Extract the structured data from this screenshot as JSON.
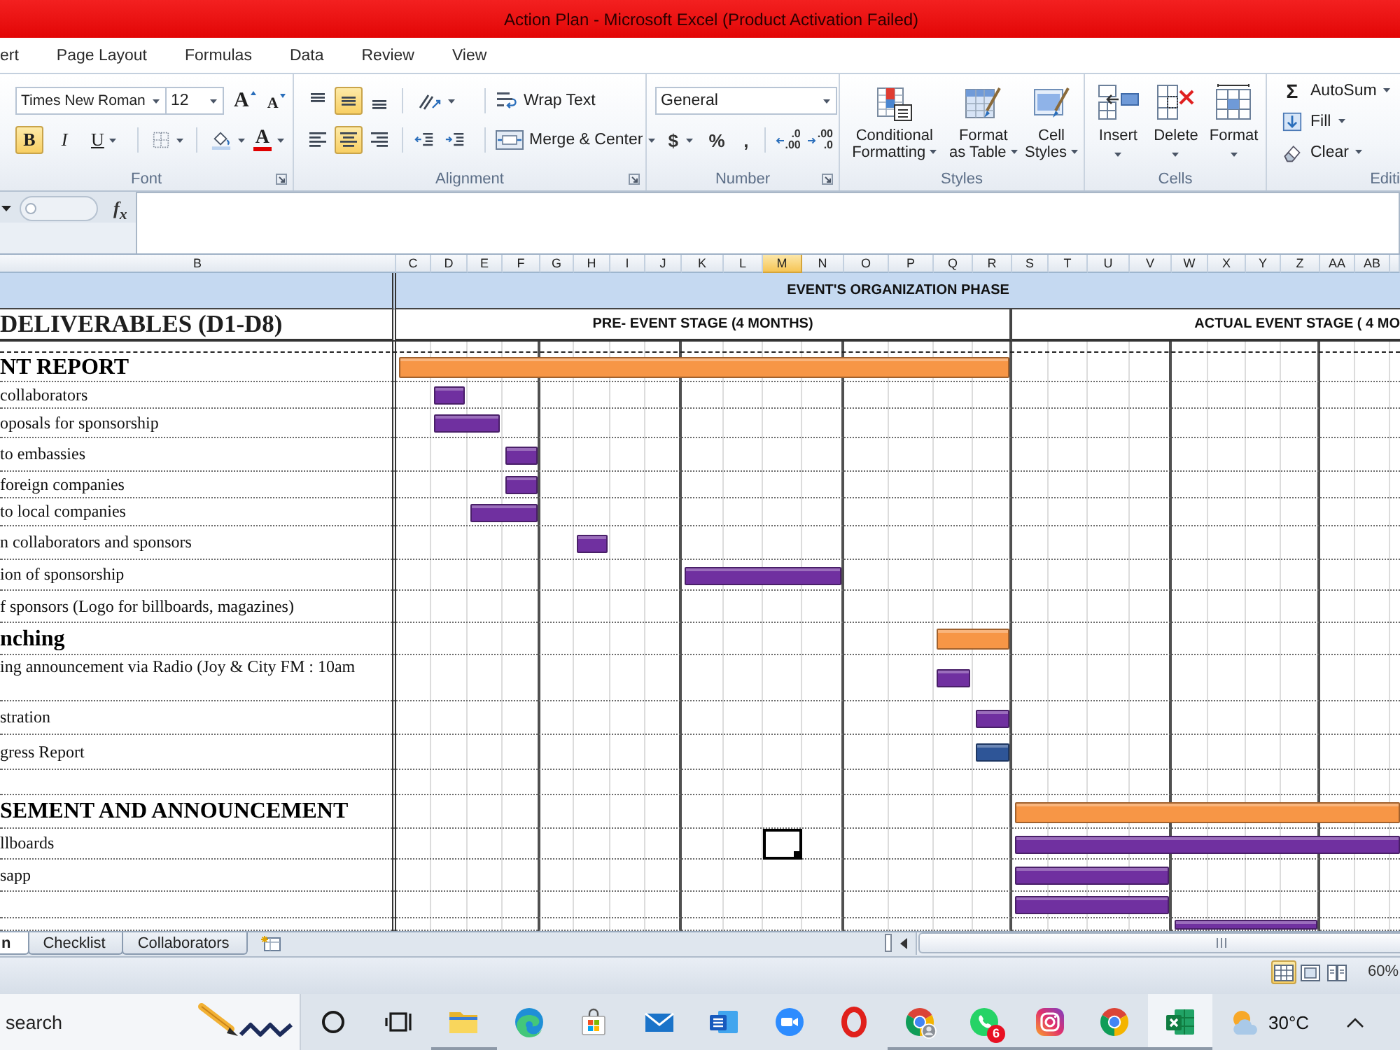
{
  "window": {
    "title": "Action Plan - Microsoft Excel (Product Activation Failed)"
  },
  "menu_tabs": [
    {
      "label": "ert",
      "selected": false
    },
    {
      "label": "Page Layout",
      "selected": false
    },
    {
      "label": "Formulas",
      "selected": false
    },
    {
      "label": "Data",
      "selected": false
    },
    {
      "label": "Review",
      "selected": false
    },
    {
      "label": "View",
      "selected": false
    }
  ],
  "ribbon": {
    "font": {
      "title": "Font",
      "font_name": "Times New Roman",
      "font_size": "12",
      "grow_label": "A",
      "shrink_label": "A",
      "styles": [
        {
          "kind": "bold",
          "label": "B",
          "on": true
        },
        {
          "kind": "italic",
          "label": "I",
          "on": false
        },
        {
          "kind": "underline",
          "label": "U",
          "on": false
        }
      ],
      "color_label": "A"
    },
    "alignment": {
      "title": "Alignment",
      "vertical": [
        {
          "kind": "top",
          "selected": false
        },
        {
          "kind": "middle",
          "selected": true
        },
        {
          "kind": "bottom",
          "selected": false
        }
      ],
      "horizontal": [
        {
          "kind": "left",
          "selected": false
        },
        {
          "kind": "center",
          "selected": true
        },
        {
          "kind": "right",
          "selected": false
        }
      ],
      "wrap_label": "Wrap Text",
      "merge_label": "Merge & Center"
    },
    "number": {
      "title": "Number",
      "format": "General",
      "symbols": [
        {
          "kind": "currency",
          "label": "$"
        },
        {
          "kind": "percent",
          "label": "%"
        },
        {
          "kind": "comma",
          "label": ","
        }
      ],
      "decimals": [
        {
          "kind": "increase",
          "lines": [
            ".0",
            ".00"
          ]
        },
        {
          "kind": "decrease",
          "lines": [
            ".00",
            ".0"
          ]
        }
      ]
    },
    "styles": {
      "title": "Styles",
      "buttons": [
        {
          "kind": "conditional",
          "lines": [
            "Conditional",
            "Formatting"
          ]
        },
        {
          "kind": "table",
          "lines": [
            "Format",
            "as Table"
          ]
        },
        {
          "kind": "cell-styles",
          "lines": [
            "Cell",
            "Styles"
          ]
        }
      ]
    },
    "cells": {
      "title": "Cells",
      "buttons": [
        {
          "kind": "insert",
          "label": "Insert"
        },
        {
          "kind": "delete",
          "label": "Delete"
        },
        {
          "kind": "format",
          "label": "Format"
        }
      ]
    },
    "editing": {
      "title": "Editi",
      "autosum": {
        "symbol": "Σ",
        "label": "AutoSum"
      },
      "fill": "Fill",
      "clear": "Clear"
    }
  },
  "formula_bar": {
    "function_label": "f$_{x}$"
  },
  "sheet": {
    "columns": [
      {
        "label": "B",
        "selected": false
      },
      {
        "label": "C",
        "selected": false
      },
      {
        "label": "D",
        "selected": false
      },
      {
        "label": "E",
        "selected": false
      },
      {
        "label": "F",
        "selected": false
      },
      {
        "label": "G",
        "selected": false
      },
      {
        "label": "H",
        "selected": false
      },
      {
        "label": "I",
        "selected": false
      },
      {
        "label": "J",
        "selected": false
      },
      {
        "label": "K",
        "selected": false
      },
      {
        "label": "L",
        "selected": false
      },
      {
        "label": "M",
        "selected": true
      },
      {
        "label": "N",
        "selected": false
      },
      {
        "label": "O",
        "selected": false
      },
      {
        "label": "P",
        "selected": false
      },
      {
        "label": "Q",
        "selected": false
      },
      {
        "label": "R",
        "selected": false
      },
      {
        "label": "S",
        "selected": false
      },
      {
        "label": "T",
        "selected": false
      },
      {
        "label": "U",
        "selected": false
      },
      {
        "label": "V",
        "selected": false
      },
      {
        "label": "W",
        "selected": false
      },
      {
        "label": "X",
        "selected": false
      },
      {
        "label": "Y",
        "selected": false
      },
      {
        "label": "Z",
        "selected": false
      },
      {
        "label": "AA",
        "selected": false
      },
      {
        "label": "AB",
        "selected": false
      }
    ],
    "phase_title": "EVENT'S ORGANIZATION PHASE",
    "deliverables_title": "DELIVERABLES (D1-D8)",
    "stages": [
      {
        "label": "PRE- EVENT STAGE (4 MONTHS)"
      },
      {
        "label": "ACTUAL EVENT STAGE ( 4 MO"
      }
    ],
    "rows": [
      {
        "kind": "spacer",
        "active_cell": false
      },
      {
        "kind": "heading",
        "label": "NT REPORT",
        "active_cell": false,
        "bar": {
          "color": "#f79646"
        }
      },
      {
        "kind": "task",
        "label": "collaborators",
        "active_cell": false,
        "bar": {
          "color": "#7030a0"
        }
      },
      {
        "kind": "task",
        "label": "oposals for sponsorship",
        "active_cell": false,
        "bar": {
          "color": "#7030a0"
        }
      },
      {
        "kind": "task",
        "label": "to embassies",
        "active_cell": false,
        "bar": {
          "color": "#7030a0"
        }
      },
      {
        "kind": "task",
        "label": "foreign companies",
        "active_cell": false,
        "bar": {
          "color": "#7030a0"
        }
      },
      {
        "kind": "task",
        "label": "to local companies",
        "active_cell": false,
        "bar": {
          "color": "#7030a0"
        }
      },
      {
        "kind": "task",
        "label": "n collaborators and sponsors",
        "active_cell": false,
        "bar": {
          "color": "#7030a0"
        }
      },
      {
        "kind": "task",
        "label": "ion of sponsorship",
        "active_cell": false,
        "bar": {
          "color": "#7030a0"
        }
      },
      {
        "kind": "task",
        "label": "f sponsors (Logo for billboards, magazines)",
        "active_cell": false
      },
      {
        "kind": "heading",
        "label": "nching",
        "active_cell": false,
        "bar": {
          "color": "#f79646"
        }
      },
      {
        "kind": "task",
        "label": "ing announcement via Radio (Joy & City FM : 10am",
        "active_cell": false,
        "bar": {
          "color": "#7030a0"
        }
      },
      {
        "kind": "task",
        "label": "stration",
        "active_cell": false,
        "bar": {
          "color": "#7030a0"
        }
      },
      {
        "kind": "task",
        "label": "gress Report",
        "active_cell": false,
        "bar": {
          "color": "#2e5597"
        }
      },
      {
        "kind": "task",
        "active_cell": false
      },
      {
        "kind": "heading",
        "label": "SEMENT AND ANNOUNCEMENT",
        "active_cell": false,
        "bar": {
          "color": "#f79646"
        }
      },
      {
        "kind": "task",
        "label": "llboards",
        "active_cell": true,
        "bar": {
          "color": "#7030a0"
        }
      },
      {
        "kind": "task",
        "label": "sapp",
        "active_cell": false,
        "bar": {
          "color": "#7030a0"
        }
      },
      {
        "kind": "task",
        "active_cell": false,
        "bar": {
          "color": "#7030a0"
        }
      },
      {
        "kind": "task",
        "active_cell": false,
        "bar": {
          "color": "#7030a0"
        }
      }
    ]
  },
  "sheet_tabs": [
    {
      "label": "n",
      "selected": true
    },
    {
      "label": "Checklist",
      "selected": false
    },
    {
      "label": "Collaborators",
      "selected": false
    }
  ],
  "status_bar": {
    "views": [
      {
        "kind": "normal",
        "selected": true
      },
      {
        "kind": "page-layout",
        "selected": false
      },
      {
        "kind": "page-break",
        "selected": false
      }
    ],
    "zoom": "60%"
  },
  "taskbar": {
    "search_placeholder": "search",
    "apps": [
      {
        "kind": "ring",
        "running": false,
        "active": false
      },
      {
        "kind": "task-view",
        "running": false,
        "active": false
      },
      {
        "kind": "folder",
        "running": true,
        "active": false
      },
      {
        "kind": "swirl",
        "running": false,
        "active": false
      },
      {
        "kind": "store-bag",
        "running": false,
        "active": false
      },
      {
        "kind": "envelope",
        "running": false,
        "active": false
      },
      {
        "kind": "doc-tile",
        "running": false,
        "active": false
      },
      {
        "kind": "video",
        "running": false,
        "active": false
      },
      {
        "kind": "red-ring",
        "running": false,
        "active": false
      },
      {
        "kind": "tricolor-avatar",
        "running": true,
        "active": false
      },
      {
        "kind": "chat-phone",
        "running": true,
        "active": false,
        "badge": "6"
      },
      {
        "kind": "camera",
        "running": true,
        "active": false
      },
      {
        "kind": "tricolor",
        "running": true,
        "active": false
      },
      {
        "kind": "spreadsheet",
        "running": true,
        "active": true
      }
    ],
    "weather": "30°C"
  }
}
